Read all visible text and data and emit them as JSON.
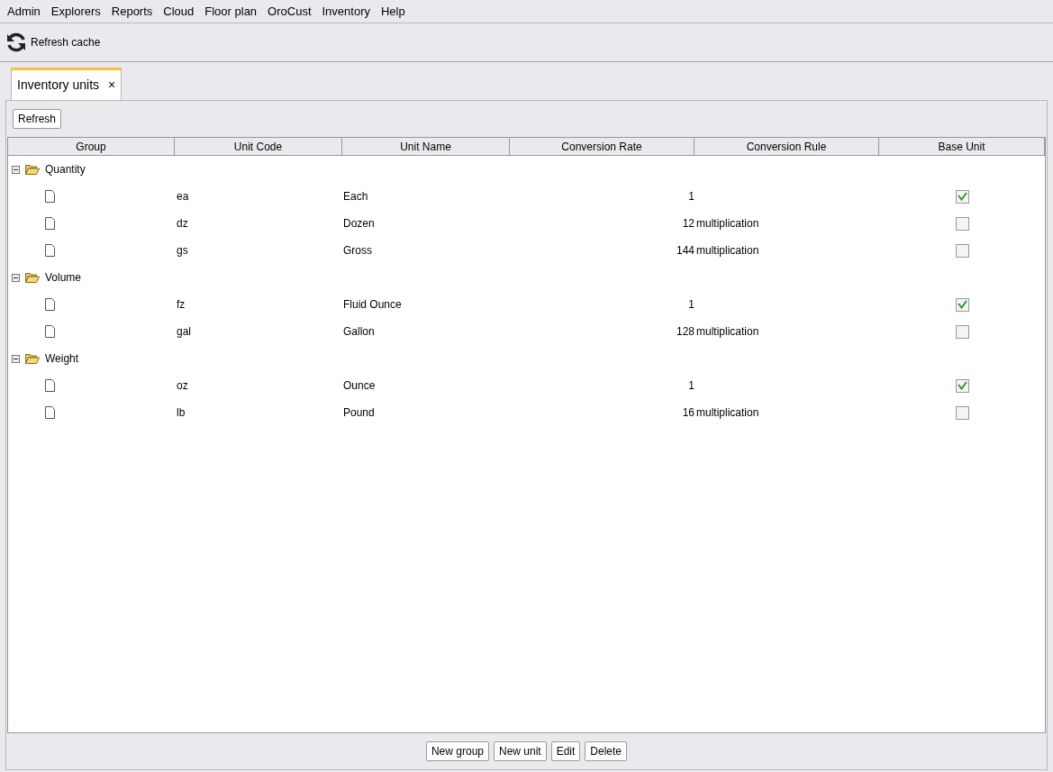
{
  "menu": [
    "Admin",
    "Explorers",
    "Reports",
    "Cloud",
    "Floor plan",
    "OroCust",
    "Inventory",
    "Help"
  ],
  "toolbar": {
    "refresh_cache": "Refresh cache"
  },
  "tabs": [
    {
      "label": "Inventory units",
      "selected": true,
      "close": "×"
    }
  ],
  "refresh_button": "Refresh",
  "table": {
    "columns": [
      "Group",
      "Unit Code",
      "Unit Name",
      "Conversion Rate",
      "Conversion Rule",
      "Base Unit"
    ],
    "groups": [
      {
        "name": "Quantity",
        "expanded": true,
        "children": [
          {
            "code": "ea",
            "name": "Each",
            "rate": "1",
            "base": true
          },
          {
            "code": "dz",
            "name": "Dozen",
            "rate": "12",
            "rule": "multiplication",
            "base": false
          },
          {
            "code": "gs",
            "name": "Gross",
            "rate": "144",
            "rule": "multiplication",
            "base": false
          }
        ]
      },
      {
        "name": "Volume",
        "expanded": true,
        "children": [
          {
            "code": "fz",
            "name": "Fluid Ounce",
            "rate": "1",
            "base": true
          },
          {
            "code": "gal",
            "name": "Gallon",
            "rate": "128",
            "rule": "multiplication",
            "base": false
          }
        ]
      },
      {
        "name": "Weight",
        "expanded": true,
        "children": [
          {
            "code": "oz",
            "name": "Ounce",
            "rate": "1",
            "base": true
          },
          {
            "code": "lb",
            "name": "Pound",
            "rate": "16",
            "rule": "multiplication",
            "base": false
          }
        ]
      }
    ]
  },
  "buttons": [
    "New group",
    "New unit",
    "Edit",
    "Delete"
  ]
}
